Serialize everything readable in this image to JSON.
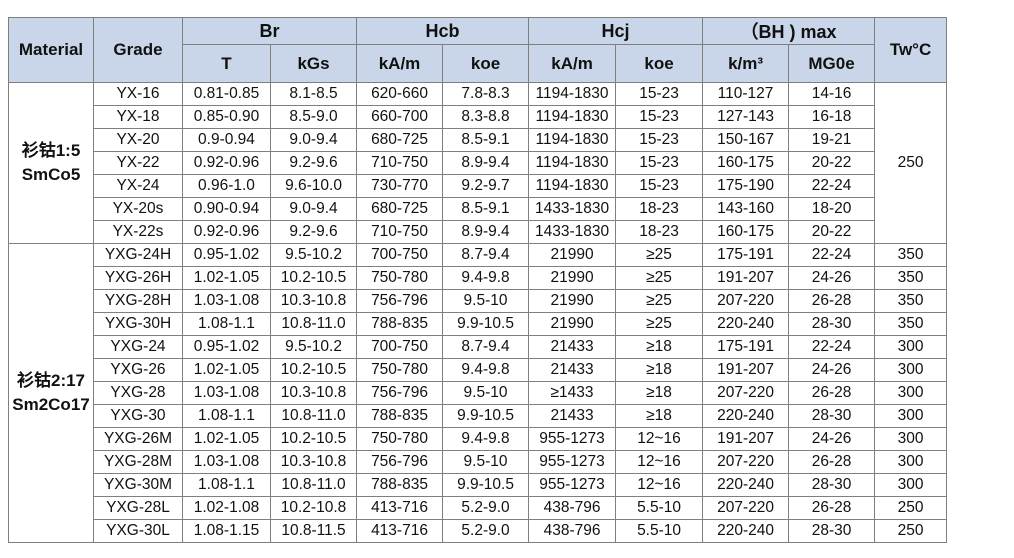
{
  "table": {
    "header": {
      "material": "Material",
      "grade": "Grade",
      "groups": {
        "br": "Br",
        "hcb": "Hcb",
        "hcj": "Hcj",
        "bhmax": "（BH ) max"
      },
      "tw": "Tw°C",
      "units": {
        "br_t": "T",
        "br_kgs": "kGs",
        "hcb_kam": "kA/m",
        "hcb_koe": "koe",
        "hcj_kam": "kA/m",
        "hcj_koe": "koe",
        "bh_km3": "k/m³",
        "bh_mgoe": "MG0e"
      }
    },
    "groups": [
      {
        "material_cn": "衫钴1:5",
        "material_en": "SmCo5",
        "tw": "250",
        "rows": [
          [
            "YX-16",
            "0.81-0.85",
            "8.1-8.5",
            "620-660",
            "7.8-8.3",
            "1194-1830",
            "15-23",
            "110-127",
            "14-16"
          ],
          [
            "YX-18",
            "0.85-0.90",
            "8.5-9.0",
            "660-700",
            "8.3-8.8",
            "1194-1830",
            "15-23",
            "127-143",
            "16-18"
          ],
          [
            "YX-20",
            "0.9-0.94",
            "9.0-9.4",
            "680-725",
            "8.5-9.1",
            "1194-1830",
            "15-23",
            "150-167",
            "19-21"
          ],
          [
            "YX-22",
            "0.92-0.96",
            "9.2-9.6",
            "710-750",
            "8.9-9.4",
            "1194-1830",
            "15-23",
            "160-175",
            "20-22"
          ],
          [
            "YX-24",
            "0.96-1.0",
            "9.6-10.0",
            "730-770",
            "9.2-9.7",
            "1194-1830",
            "15-23",
            "175-190",
            "22-24"
          ],
          [
            "YX-20s",
            "0.90-0.94",
            "9.0-9.4",
            "680-725",
            "8.5-9.1",
            "1433-1830",
            "18-23",
            "143-160",
            "18-20"
          ],
          [
            "YX-22s",
            "0.92-0.96",
            "9.2-9.6",
            "710-750",
            "8.9-9.4",
            "1433-1830",
            "18-23",
            "160-175",
            "20-22"
          ]
        ]
      },
      {
        "material_cn": "衫钴2:17",
        "material_en": "Sm2Co17",
        "rows": [
          [
            "YXG-24H",
            "0.95-1.02",
            "9.5-10.2",
            "700-750",
            "8.7-9.4",
            "21990",
            "≥25",
            "175-191",
            "22-24",
            "350"
          ],
          [
            "YXG-26H",
            "1.02-1.05",
            "10.2-10.5",
            "750-780",
            "9.4-9.8",
            "21990",
            "≥25",
            "191-207",
            "24-26",
            "350"
          ],
          [
            "YXG-28H",
            "1.03-1.08",
            "10.3-10.8",
            "756-796",
            "9.5-10",
            "21990",
            "≥25",
            "207-220",
            "26-28",
            "350"
          ],
          [
            "YXG-30H",
            "1.08-1.1",
            "10.8-11.0",
            "788-835",
            "9.9-10.5",
            "21990",
            "≥25",
            "220-240",
            "28-30",
            "350"
          ],
          [
            "YXG-24",
            "0.95-1.02",
            "9.5-10.2",
            "700-750",
            "8.7-9.4",
            "21433",
            "≥18",
            "175-191",
            "22-24",
            "300"
          ],
          [
            "YXG-26",
            "1.02-1.05",
            "10.2-10.5",
            "750-780",
            "9.4-9.8",
            "21433",
            "≥18",
            "191-207",
            "24-26",
            "300"
          ],
          [
            "YXG-28",
            "1.03-1.08",
            "10.3-10.8",
            "756-796",
            "9.5-10",
            "≥1433",
            "≥18",
            "207-220",
            "26-28",
            "300"
          ],
          [
            "YXG-30",
            "1.08-1.1",
            "10.8-11.0",
            "788-835",
            "9.9-10.5",
            "21433",
            "≥18",
            "220-240",
            "28-30",
            "300"
          ],
          [
            "YXG-26M",
            "1.02-1.05",
            "10.2-10.5",
            "750-780",
            "9.4-9.8",
            "955-1273",
            "12~16",
            "191-207",
            "24-26",
            "300"
          ],
          [
            "YXG-28M",
            "1.03-1.08",
            "10.3-10.8",
            "756-796",
            "9.5-10",
            "955-1273",
            "12~16",
            "207-220",
            "26-28",
            "300"
          ],
          [
            "YXG-30M",
            "1.08-1.1",
            "10.8-11.0",
            "788-835",
            "9.9-10.5",
            "955-1273",
            "12~16",
            "220-240",
            "28-30",
            "300"
          ],
          [
            "YXG-28L",
            "1.02-1.08",
            "10.2-10.8",
            "413-716",
            "5.2-9.0",
            "438-796",
            "5.5-10",
            "207-220",
            "26-28",
            "250"
          ],
          [
            "YXG-30L",
            "1.08-1.15",
            "10.8-11.5",
            "413-716",
            "5.2-9.0",
            "438-796",
            "5.5-10",
            "220-240",
            "28-30",
            "250"
          ]
        ]
      }
    ]
  }
}
